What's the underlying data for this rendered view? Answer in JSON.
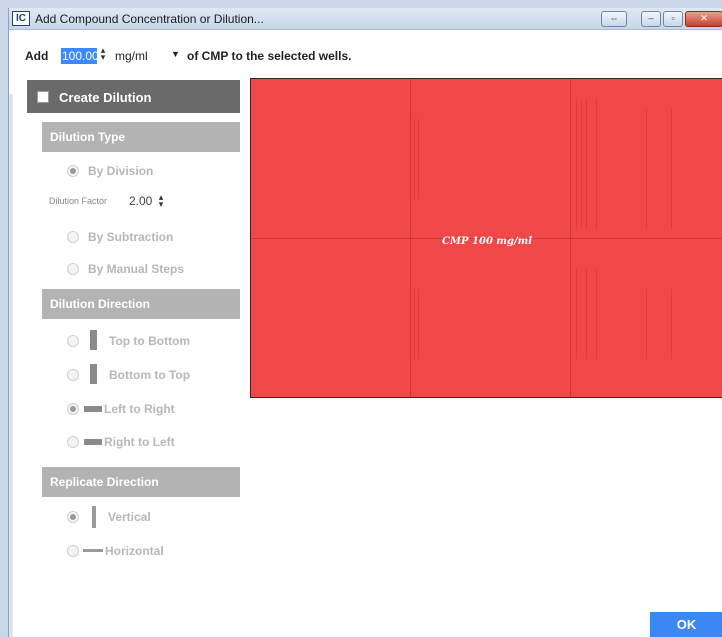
{
  "window": {
    "app_icon_text": "IC",
    "title": "Add Compound Concentration or Dilution...",
    "buttons": {
      "swap": "⇔",
      "minimize": "–",
      "maximize": "▫",
      "close": "✕"
    }
  },
  "top": {
    "add_label": "Add",
    "concentration_value": "100.00",
    "unit": "mg/ml",
    "suffix": "of CMP to the selected wells."
  },
  "create_dilution": {
    "label": "Create Dilution",
    "checked": false
  },
  "dilution_type": {
    "header": "Dilution Type",
    "options": [
      "By Division",
      "By Subtraction",
      "By Manual Steps"
    ],
    "selected": "By Division",
    "factor_label": "Dilution Factor",
    "factor_value": "2.00"
  },
  "dilution_direction": {
    "header": "Dilution Direction",
    "options": [
      "Top to Bottom",
      "Bottom to Top",
      "Left to Right",
      "Right to Left"
    ],
    "selected": "Left to Right"
  },
  "replicate_direction": {
    "header": "Replicate Direction",
    "options": [
      "Vertical",
      "Horizontal"
    ],
    "selected": "Vertical"
  },
  "plate": {
    "label": "CMP 100 mg/ml",
    "fill_color": "#f04848"
  },
  "footer": {
    "ok_label": "OK"
  },
  "colors": {
    "accent": "#3b88f5",
    "section_header": "#b3b3b3",
    "create_header": "#6a6a6a",
    "disabled_text": "#b7b7b7"
  }
}
